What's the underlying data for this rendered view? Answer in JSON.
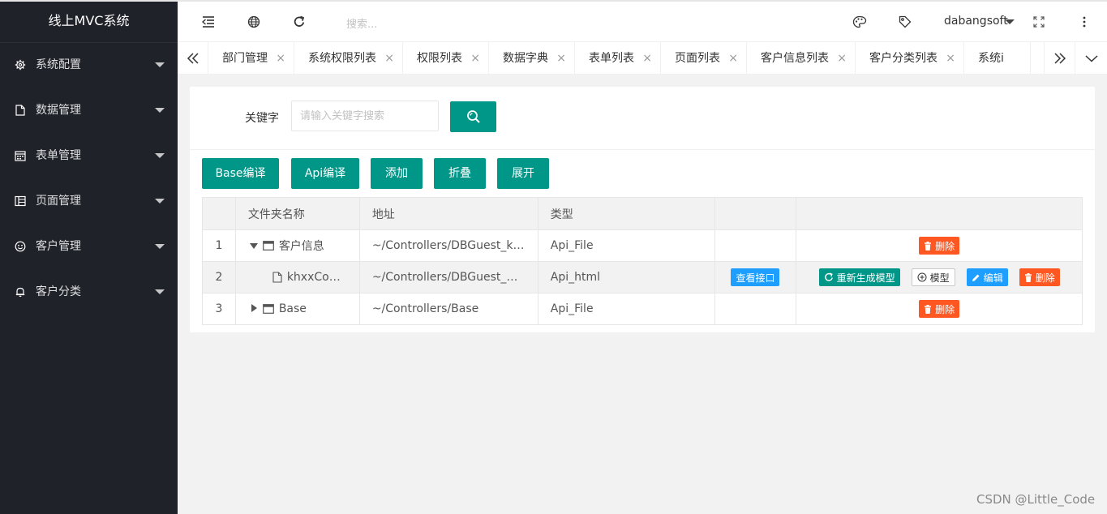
{
  "app": {
    "title": "线上MVC系统"
  },
  "sidebar": {
    "items": [
      {
        "label": "系统配置",
        "icon": "gear-icon"
      },
      {
        "label": "数据管理",
        "icon": "file-icon"
      },
      {
        "label": "表单管理",
        "icon": "calendar-icon"
      },
      {
        "label": "页面管理",
        "icon": "template-icon"
      },
      {
        "label": "客户管理",
        "icon": "smile-icon"
      },
      {
        "label": "客户分类",
        "icon": "bell-icon"
      }
    ]
  },
  "header": {
    "search_placeholder": "搜索...",
    "username": "dabangsoft",
    "icons": [
      "shrink-menu-icon",
      "globe-icon",
      "refresh-icon",
      "theme-palette-icon",
      "tag-icon",
      "fullscreen-icon",
      "more-icon"
    ]
  },
  "tabs": {
    "items": [
      {
        "label": "部门管理"
      },
      {
        "label": "系统权限列表"
      },
      {
        "label": "权限列表"
      },
      {
        "label": "数据字典"
      },
      {
        "label": "表单列表"
      },
      {
        "label": "页面列表"
      },
      {
        "label": "客户信息列表"
      },
      {
        "label": "客户分类列表"
      },
      {
        "label": "系统i"
      }
    ],
    "close_glyph": "×"
  },
  "search": {
    "label": "关键字",
    "placeholder": "请输入关键字搜索"
  },
  "toolbar": {
    "base_compile": "Base编译",
    "api_compile": "Api编译",
    "add": "添加",
    "collapse": "折叠",
    "expand": "展开"
  },
  "table": {
    "headers": [
      "",
      "文件夹名称",
      "地址",
      "类型",
      "",
      ""
    ],
    "rows": [
      {
        "index": "1",
        "name": "客户信息",
        "path": "~/Controllers/DBGuest_khxx",
        "type": "Api_File"
      },
      {
        "index": "2",
        "name": "khxxController",
        "path": "~/Controllers/DBGuest_khxx/khxxController",
        "type": "Api_html"
      },
      {
        "index": "3",
        "name": "Base",
        "path": "~/Controllers/Base",
        "type": "Api_File"
      }
    ],
    "actions": {
      "view_api": "查看接口",
      "regen_model": "重新生成模型",
      "model": "模型",
      "edit": "编辑",
      "delete": "删除"
    }
  },
  "watermark": "CSDN @Little_Code",
  "colors": {
    "primary": "#009688",
    "danger": "#ff5722",
    "info": "#1e9fff",
    "sidebar_bg": "#20222a"
  }
}
